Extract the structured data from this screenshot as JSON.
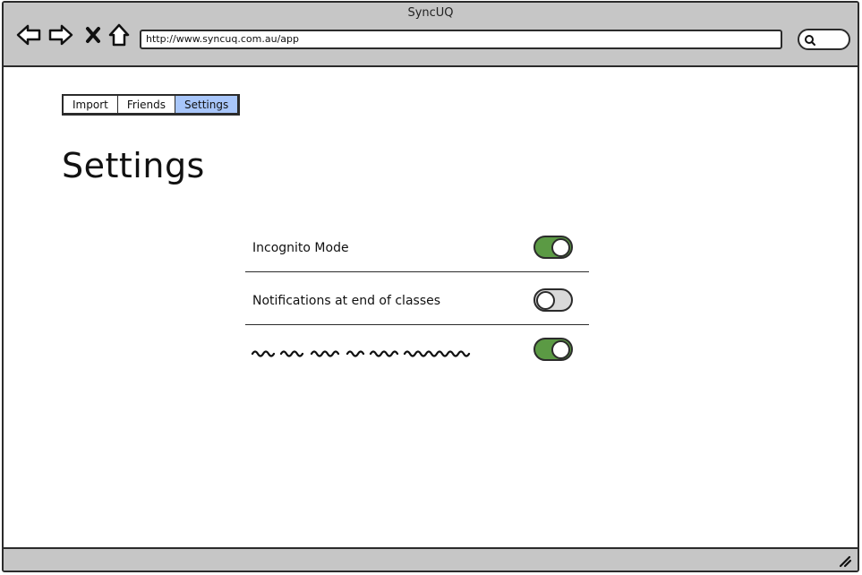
{
  "window": {
    "title": "SyncUQ",
    "url": "http://www.syncuq.com.au/app"
  },
  "icons": {
    "back": "arrow-left-icon",
    "forward": "arrow-right-icon",
    "stop": "close-icon",
    "home": "home-icon",
    "search": "search-icon",
    "resize": "resize-grip-icon"
  },
  "tabs": [
    {
      "label": "Import",
      "active": false
    },
    {
      "label": "Friends",
      "active": false
    },
    {
      "label": "Settings",
      "active": true
    }
  ],
  "page": {
    "title": "Settings"
  },
  "settings": [
    {
      "label": "Incognito Mode",
      "enabled": true
    },
    {
      "label": "Notifications at end of classes",
      "enabled": false
    },
    {
      "label": "",
      "placeholder": true,
      "enabled": true
    }
  ],
  "colors": {
    "toggle_on": "#5b9a44",
    "toggle_off": "#d9d9d9",
    "tab_active": "#a8c6fa",
    "chrome": "#c6c6c6"
  }
}
